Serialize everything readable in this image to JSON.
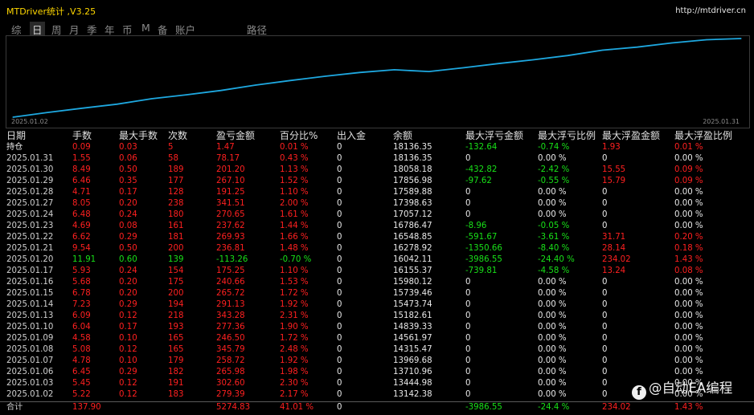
{
  "window": {
    "title": "MTDriver统计 ,V3.25",
    "url": "http://mtdriver.cn"
  },
  "tabs": [
    {
      "label": "综",
      "active": false
    },
    {
      "label": "日",
      "active": true
    },
    {
      "label": "周",
      "active": false
    },
    {
      "label": "月",
      "active": false
    },
    {
      "label": "季",
      "active": false
    },
    {
      "label": "年",
      "active": false
    },
    {
      "label": "币",
      "active": false
    },
    {
      "label": "M",
      "active": false
    },
    {
      "label": "备",
      "active": false
    },
    {
      "label": "账户",
      "active": false
    },
    {
      "label": "路径",
      "active": false
    }
  ],
  "chart_data": {
    "type": "line",
    "x_start_label": "2025.01.02",
    "x_end_label": "2025.01.31",
    "line_color": "#1ea8e0",
    "series": [
      {
        "x": [
          "2025.01.02",
          "2025.01.03",
          "2025.01.06",
          "2025.01.07",
          "2025.01.08",
          "2025.01.09",
          "2025.01.10",
          "2025.01.13",
          "2025.01.14",
          "2025.01.15",
          "2025.01.16",
          "2025.01.17",
          "2025.01.20",
          "2025.01.21",
          "2025.01.22",
          "2025.01.23",
          "2025.01.24",
          "2025.01.27",
          "2025.01.28",
          "2025.01.29",
          "2025.01.30",
          "2025.01.31"
        ],
        "values": [
          13142.38,
          13444.98,
          13710.96,
          13969.68,
          14315.47,
          14561.97,
          14839.33,
          15182.61,
          15473.74,
          15739.46,
          15980.12,
          16155.37,
          16042.11,
          16278.92,
          16548.85,
          16786.47,
          17057.12,
          17398.63,
          17589.88,
          17856.98,
          18058.18,
          18136.35
        ]
      }
    ]
  },
  "table": {
    "headers": [
      "日期",
      "手数",
      "最大手数",
      "次数",
      "盈亏金额",
      "百分比%",
      "出入金",
      "余额",
      "最大浮亏金额",
      "最大浮亏比例",
      "最大浮盈金额",
      "最大浮盈比例"
    ],
    "rows": [
      {
        "kind": "position",
        "cells": [
          "持仓",
          "0.09",
          "0.03",
          "5",
          "1.47",
          "0.01 %",
          "0",
          "18136.35",
          "-132.64",
          "-0.74 %",
          "1.93",
          "0.01 %"
        ],
        "colors": [
          "white",
          "red",
          "red",
          "red",
          "red",
          "red",
          "white",
          "white",
          "green",
          "green",
          "red",
          "red"
        ]
      },
      {
        "kind": "day",
        "cells": [
          "2025.01.31",
          "1.55",
          "0.06",
          "58",
          "78.17",
          "0.43 %",
          "0",
          "18136.35",
          "0",
          "0.00 %",
          "0",
          "0.00 %"
        ],
        "colors": [
          "grey",
          "red",
          "red",
          "red",
          "red",
          "red",
          "white",
          "white",
          "white",
          "white",
          "white",
          "white"
        ]
      },
      {
        "kind": "day",
        "cells": [
          "2025.01.30",
          "8.49",
          "0.50",
          "189",
          "201.20",
          "1.13 %",
          "0",
          "18058.18",
          "-432.82",
          "-2.42 %",
          "15.55",
          "0.09 %"
        ],
        "colors": [
          "grey",
          "red",
          "red",
          "red",
          "red",
          "red",
          "white",
          "white",
          "green",
          "green",
          "red",
          "red"
        ]
      },
      {
        "kind": "day",
        "cells": [
          "2025.01.29",
          "6.46",
          "0.35",
          "177",
          "267.10",
          "1.52 %",
          "0",
          "17856.98",
          "-97.62",
          "-0.55 %",
          "15.79",
          "0.09 %"
        ],
        "colors": [
          "grey",
          "red",
          "red",
          "red",
          "red",
          "red",
          "white",
          "white",
          "green",
          "green",
          "red",
          "red"
        ]
      },
      {
        "kind": "day",
        "cells": [
          "2025.01.28",
          "4.71",
          "0.17",
          "128",
          "191.25",
          "1.10 %",
          "0",
          "17589.88",
          "0",
          "0.00 %",
          "0",
          "0.00 %"
        ],
        "colors": [
          "grey",
          "red",
          "red",
          "red",
          "red",
          "red",
          "white",
          "white",
          "white",
          "white",
          "white",
          "white"
        ]
      },
      {
        "kind": "day",
        "cells": [
          "2025.01.27",
          "8.05",
          "0.20",
          "238",
          "341.51",
          "2.00 %",
          "0",
          "17398.63",
          "0",
          "0.00 %",
          "0",
          "0.00 %"
        ],
        "colors": [
          "grey",
          "red",
          "red",
          "red",
          "red",
          "red",
          "white",
          "white",
          "white",
          "white",
          "white",
          "white"
        ]
      },
      {
        "kind": "day",
        "cells": [
          "2025.01.24",
          "6.48",
          "0.24",
          "180",
          "270.65",
          "1.61 %",
          "0",
          "17057.12",
          "0",
          "0.00 %",
          "0",
          "0.00 %"
        ],
        "colors": [
          "grey",
          "red",
          "red",
          "red",
          "red",
          "red",
          "white",
          "white",
          "white",
          "white",
          "white",
          "white"
        ]
      },
      {
        "kind": "day",
        "cells": [
          "2025.01.23",
          "4.69",
          "0.08",
          "161",
          "237.62",
          "1.44 %",
          "0",
          "16786.47",
          "-8.96",
          "-0.05 %",
          "0",
          "0.00 %"
        ],
        "colors": [
          "grey",
          "red",
          "red",
          "red",
          "red",
          "red",
          "white",
          "white",
          "green",
          "green",
          "white",
          "white"
        ]
      },
      {
        "kind": "day",
        "cells": [
          "2025.01.22",
          "6.62",
          "0.29",
          "181",
          "269.93",
          "1.66 %",
          "0",
          "16548.85",
          "-591.67",
          "-3.61 %",
          "31.71",
          "0.20 %"
        ],
        "colors": [
          "grey",
          "red",
          "red",
          "red",
          "red",
          "red",
          "white",
          "white",
          "green",
          "green",
          "red",
          "red"
        ]
      },
      {
        "kind": "day",
        "cells": [
          "2025.01.21",
          "9.54",
          "0.50",
          "200",
          "236.81",
          "1.48 %",
          "0",
          "16278.92",
          "-1350.66",
          "-8.40 %",
          "28.14",
          "0.18 %"
        ],
        "colors": [
          "grey",
          "red",
          "red",
          "red",
          "red",
          "red",
          "white",
          "white",
          "green",
          "green",
          "red",
          "red"
        ]
      },
      {
        "kind": "day",
        "cells": [
          "2025.01.20",
          "11.91",
          "0.60",
          "139",
          "-113.26",
          "-0.70 %",
          "0",
          "16042.11",
          "-3986.55",
          "-24.40 %",
          "234.02",
          "1.43 %"
        ],
        "colors": [
          "grey",
          "green",
          "green",
          "green",
          "green",
          "green",
          "white",
          "white",
          "green",
          "green",
          "red",
          "red"
        ]
      },
      {
        "kind": "day",
        "cells": [
          "2025.01.17",
          "5.93",
          "0.24",
          "154",
          "175.25",
          "1.10 %",
          "0",
          "16155.37",
          "-739.81",
          "-4.58 %",
          "13.24",
          "0.08 %"
        ],
        "colors": [
          "grey",
          "red",
          "red",
          "red",
          "red",
          "red",
          "white",
          "white",
          "green",
          "green",
          "red",
          "red"
        ]
      },
      {
        "kind": "day",
        "cells": [
          "2025.01.16",
          "5.68",
          "0.20",
          "175",
          "240.66",
          "1.53 %",
          "0",
          "15980.12",
          "0",
          "0.00 %",
          "0",
          "0.00 %"
        ],
        "colors": [
          "grey",
          "red",
          "red",
          "red",
          "red",
          "red",
          "white",
          "white",
          "white",
          "white",
          "white",
          "white"
        ]
      },
      {
        "kind": "day",
        "cells": [
          "2025.01.15",
          "6.78",
          "0.20",
          "200",
          "265.72",
          "1.72 %",
          "0",
          "15739.46",
          "0",
          "0.00 %",
          "0",
          "0.00 %"
        ],
        "colors": [
          "grey",
          "red",
          "red",
          "red",
          "red",
          "red",
          "white",
          "white",
          "white",
          "white",
          "white",
          "white"
        ]
      },
      {
        "kind": "day",
        "cells": [
          "2025.01.14",
          "7.23",
          "0.29",
          "194",
          "291.13",
          "1.92 %",
          "0",
          "15473.74",
          "0",
          "0.00 %",
          "0",
          "0.00 %"
        ],
        "colors": [
          "grey",
          "red",
          "red",
          "red",
          "red",
          "red",
          "white",
          "white",
          "white",
          "white",
          "white",
          "white"
        ]
      },
      {
        "kind": "day",
        "cells": [
          "2025.01.13",
          "6.09",
          "0.12",
          "218",
          "343.28",
          "2.31 %",
          "0",
          "15182.61",
          "0",
          "0.00 %",
          "0",
          "0.00 %"
        ],
        "colors": [
          "grey",
          "red",
          "red",
          "red",
          "red",
          "red",
          "white",
          "white",
          "white",
          "white",
          "white",
          "white"
        ]
      },
      {
        "kind": "day",
        "cells": [
          "2025.01.10",
          "6.04",
          "0.17",
          "193",
          "277.36",
          "1.90 %",
          "0",
          "14839.33",
          "0",
          "0.00 %",
          "0",
          "0.00 %"
        ],
        "colors": [
          "grey",
          "red",
          "red",
          "red",
          "red",
          "red",
          "white",
          "white",
          "white",
          "white",
          "white",
          "white"
        ]
      },
      {
        "kind": "day",
        "cells": [
          "2025.01.09",
          "4.58",
          "0.10",
          "165",
          "246.50",
          "1.72 %",
          "0",
          "14561.97",
          "0",
          "0.00 %",
          "0",
          "0.00 %"
        ],
        "colors": [
          "grey",
          "red",
          "red",
          "red",
          "red",
          "red",
          "white",
          "white",
          "white",
          "white",
          "white",
          "white"
        ]
      },
      {
        "kind": "day",
        "cells": [
          "2025.01.08",
          "5.08",
          "0.12",
          "165",
          "345.79",
          "2.48 %",
          "0",
          "14315.47",
          "0",
          "0.00 %",
          "0",
          "0.00 %"
        ],
        "colors": [
          "grey",
          "red",
          "red",
          "red",
          "red",
          "red",
          "white",
          "white",
          "white",
          "white",
          "white",
          "white"
        ]
      },
      {
        "kind": "day",
        "cells": [
          "2025.01.07",
          "4.78",
          "0.10",
          "179",
          "258.72",
          "1.92 %",
          "0",
          "13969.68",
          "0",
          "0.00 %",
          "0",
          "0.00 %"
        ],
        "colors": [
          "grey",
          "red",
          "red",
          "red",
          "red",
          "red",
          "white",
          "white",
          "white",
          "white",
          "white",
          "white"
        ]
      },
      {
        "kind": "day",
        "cells": [
          "2025.01.06",
          "6.45",
          "0.29",
          "182",
          "265.98",
          "1.98 %",
          "0",
          "13710.96",
          "0",
          "0.00 %",
          "0",
          "0.00 %"
        ],
        "colors": [
          "grey",
          "red",
          "red",
          "red",
          "red",
          "red",
          "white",
          "white",
          "white",
          "white",
          "white",
          "white"
        ]
      },
      {
        "kind": "day",
        "cells": [
          "2025.01.03",
          "5.45",
          "0.12",
          "191",
          "302.60",
          "2.30 %",
          "0",
          "13444.98",
          "0",
          "0.00 %",
          "0",
          "0.00 %"
        ],
        "colors": [
          "grey",
          "red",
          "red",
          "red",
          "red",
          "red",
          "white",
          "white",
          "white",
          "white",
          "white",
          "white"
        ]
      },
      {
        "kind": "day",
        "cells": [
          "2025.01.02",
          "5.22",
          "0.12",
          "183",
          "279.39",
          "2.17 %",
          "0",
          "13142.38",
          "0",
          "0.00 %",
          "0",
          "0.00 %"
        ],
        "colors": [
          "grey",
          "red",
          "red",
          "red",
          "red",
          "red",
          "white",
          "white",
          "white",
          "white",
          "white",
          "white"
        ]
      }
    ],
    "total": {
      "cells": [
        "合计",
        "137.90",
        "",
        "",
        "5274.83",
        "41.01 %",
        "0",
        "",
        "-3986.55",
        "-24.4 %",
        "234.02",
        "1.43 %"
      ],
      "colors": [
        "grey",
        "red",
        "red",
        "red",
        "red",
        "red",
        "white",
        "white",
        "green",
        "green",
        "red",
        "red"
      ]
    }
  },
  "watermark": {
    "text": "@自动EA编程"
  },
  "colors": {
    "red": "#ff2020",
    "green": "#18e018",
    "title": "#ffd700",
    "line": "#1ea8e0"
  }
}
